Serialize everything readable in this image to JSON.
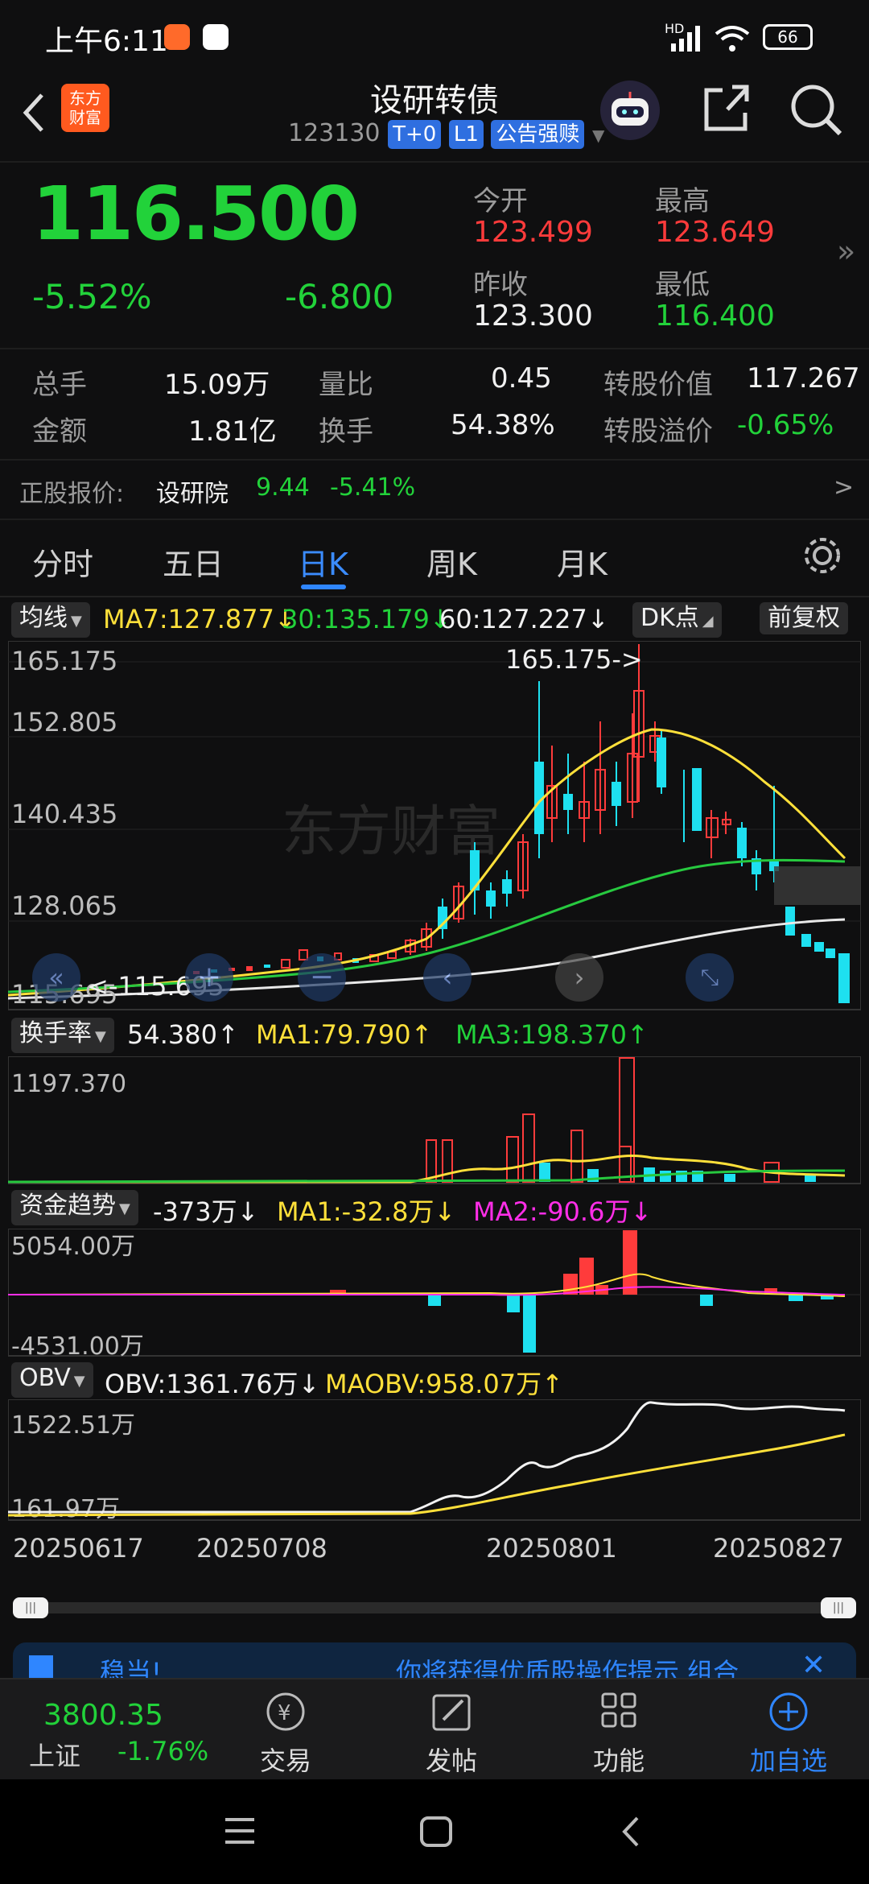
{
  "status_bar": {
    "time": "上午6:11",
    "battery": "66",
    "network": "HD"
  },
  "header": {
    "title": "设研转债",
    "code": "123130",
    "tags": [
      "T+0",
      "L1",
      "公告强赎"
    ],
    "logo_text_1": "东方",
    "logo_text_2": "财富"
  },
  "quote": {
    "price": "116.500",
    "change_pct": "-5.52%",
    "change": "-6.800",
    "open_label": "今开",
    "open": "123.499",
    "high_label": "最高",
    "high": "123.649",
    "prev_close_label": "昨收",
    "prev_close": "123.300",
    "low_label": "最低",
    "low": "116.400"
  },
  "stats": {
    "volume_label": "总手",
    "volume": "15.09万",
    "vol_ratio_label": "量比",
    "vol_ratio": "0.45",
    "conv_value_label": "转股价值",
    "conv_value": "117.267",
    "amount_label": "金额",
    "amount": "1.81亿",
    "turnover_label": "换手",
    "turnover": "54.38%",
    "premium_label": "转股溢价",
    "premium": "-0.65%"
  },
  "underlying": {
    "label": "正股报价:",
    "name": "设研院",
    "price": "9.44",
    "change": "-5.41%",
    "arrow": ">"
  },
  "tabs": [
    "分时",
    "五日",
    "日K",
    "周K",
    "月K",
    "更多"
  ],
  "active_tab": "日K",
  "ma_bar": {
    "selector": "均线",
    "ma7": "MA7:127.877",
    "ma30": "30:135.179",
    "ma60": "60:127.227",
    "dk": "DK点",
    "adjust": "前复权"
  },
  "kline": {
    "ticks": [
      "165.175",
      "152.805",
      "140.435",
      "128.065",
      "115.695"
    ],
    "max_marker": "165.175->",
    "min_marker": "<-115.695",
    "watermark": "东方财富"
  },
  "turnover_panel": {
    "selector": "换手率",
    "value": "54.380",
    "ma1": "MA1:79.790",
    "ma3": "MA3:198.370",
    "top": "1197.370"
  },
  "fund_panel": {
    "selector": "资金趋势",
    "value": "-373万",
    "ma1": "MA1:-32.8万",
    "ma2": "MA2:-90.6万",
    "top": "5054.00万",
    "bottom": "-4531.00万"
  },
  "obv_panel": {
    "selector": "OBV",
    "obv": "OBV:1361.76万",
    "maobv": "MAOBV:958.07万",
    "top": "1522.51万",
    "bottom": "161.97万"
  },
  "dates": [
    "20250617",
    "20250708",
    "20250801",
    "20250827"
  ],
  "banner": {
    "left": "稳当!",
    "right": "你将获得优质股操作提示 组合"
  },
  "bottom_nav": {
    "index_value": "3800.35",
    "index_name": "上证",
    "index_change": "-1.76%",
    "trade": "交易",
    "post": "发帖",
    "func": "功能",
    "add": "加自选"
  },
  "colors": {
    "up": "#ff3b3b",
    "down": "#22d23a",
    "down_candle": "#1ee0f0",
    "ma7": "#ffe03a",
    "ma30": "#27c93f",
    "ma60": "#e8e8e8",
    "accent": "#2f86ff"
  }
}
